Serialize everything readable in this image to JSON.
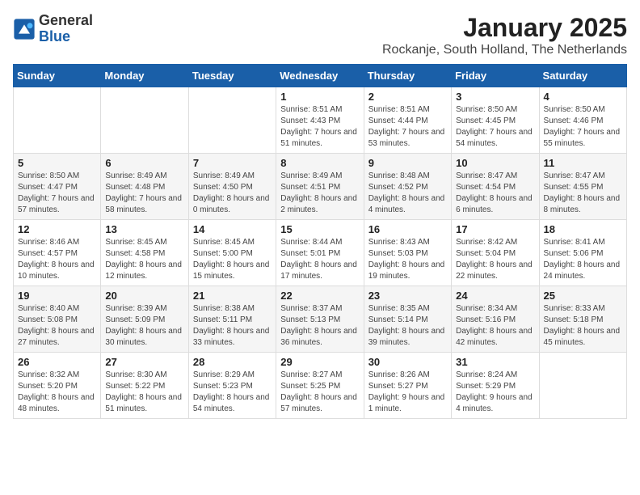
{
  "app": {
    "name_general": "General",
    "name_blue": "Blue"
  },
  "header": {
    "title": "January 2025",
    "subtitle": "Rockanje, South Holland, The Netherlands"
  },
  "calendar": {
    "days_of_week": [
      "Sunday",
      "Monday",
      "Tuesday",
      "Wednesday",
      "Thursday",
      "Friday",
      "Saturday"
    ],
    "weeks": [
      [
        {
          "day": "",
          "info": ""
        },
        {
          "day": "",
          "info": ""
        },
        {
          "day": "",
          "info": ""
        },
        {
          "day": "1",
          "info": "Sunrise: 8:51 AM\nSunset: 4:43 PM\nDaylight: 7 hours and 51 minutes."
        },
        {
          "day": "2",
          "info": "Sunrise: 8:51 AM\nSunset: 4:44 PM\nDaylight: 7 hours and 53 minutes."
        },
        {
          "day": "3",
          "info": "Sunrise: 8:50 AM\nSunset: 4:45 PM\nDaylight: 7 hours and 54 minutes."
        },
        {
          "day": "4",
          "info": "Sunrise: 8:50 AM\nSunset: 4:46 PM\nDaylight: 7 hours and 55 minutes."
        }
      ],
      [
        {
          "day": "5",
          "info": "Sunrise: 8:50 AM\nSunset: 4:47 PM\nDaylight: 7 hours and 57 minutes."
        },
        {
          "day": "6",
          "info": "Sunrise: 8:49 AM\nSunset: 4:48 PM\nDaylight: 7 hours and 58 minutes."
        },
        {
          "day": "7",
          "info": "Sunrise: 8:49 AM\nSunset: 4:50 PM\nDaylight: 8 hours and 0 minutes."
        },
        {
          "day": "8",
          "info": "Sunrise: 8:49 AM\nSunset: 4:51 PM\nDaylight: 8 hours and 2 minutes."
        },
        {
          "day": "9",
          "info": "Sunrise: 8:48 AM\nSunset: 4:52 PM\nDaylight: 8 hours and 4 minutes."
        },
        {
          "day": "10",
          "info": "Sunrise: 8:47 AM\nSunset: 4:54 PM\nDaylight: 8 hours and 6 minutes."
        },
        {
          "day": "11",
          "info": "Sunrise: 8:47 AM\nSunset: 4:55 PM\nDaylight: 8 hours and 8 minutes."
        }
      ],
      [
        {
          "day": "12",
          "info": "Sunrise: 8:46 AM\nSunset: 4:57 PM\nDaylight: 8 hours and 10 minutes."
        },
        {
          "day": "13",
          "info": "Sunrise: 8:45 AM\nSunset: 4:58 PM\nDaylight: 8 hours and 12 minutes."
        },
        {
          "day": "14",
          "info": "Sunrise: 8:45 AM\nSunset: 5:00 PM\nDaylight: 8 hours and 15 minutes."
        },
        {
          "day": "15",
          "info": "Sunrise: 8:44 AM\nSunset: 5:01 PM\nDaylight: 8 hours and 17 minutes."
        },
        {
          "day": "16",
          "info": "Sunrise: 8:43 AM\nSunset: 5:03 PM\nDaylight: 8 hours and 19 minutes."
        },
        {
          "day": "17",
          "info": "Sunrise: 8:42 AM\nSunset: 5:04 PM\nDaylight: 8 hours and 22 minutes."
        },
        {
          "day": "18",
          "info": "Sunrise: 8:41 AM\nSunset: 5:06 PM\nDaylight: 8 hours and 24 minutes."
        }
      ],
      [
        {
          "day": "19",
          "info": "Sunrise: 8:40 AM\nSunset: 5:08 PM\nDaylight: 8 hours and 27 minutes."
        },
        {
          "day": "20",
          "info": "Sunrise: 8:39 AM\nSunset: 5:09 PM\nDaylight: 8 hours and 30 minutes."
        },
        {
          "day": "21",
          "info": "Sunrise: 8:38 AM\nSunset: 5:11 PM\nDaylight: 8 hours and 33 minutes."
        },
        {
          "day": "22",
          "info": "Sunrise: 8:37 AM\nSunset: 5:13 PM\nDaylight: 8 hours and 36 minutes."
        },
        {
          "day": "23",
          "info": "Sunrise: 8:35 AM\nSunset: 5:14 PM\nDaylight: 8 hours and 39 minutes."
        },
        {
          "day": "24",
          "info": "Sunrise: 8:34 AM\nSunset: 5:16 PM\nDaylight: 8 hours and 42 minutes."
        },
        {
          "day": "25",
          "info": "Sunrise: 8:33 AM\nSunset: 5:18 PM\nDaylight: 8 hours and 45 minutes."
        }
      ],
      [
        {
          "day": "26",
          "info": "Sunrise: 8:32 AM\nSunset: 5:20 PM\nDaylight: 8 hours and 48 minutes."
        },
        {
          "day": "27",
          "info": "Sunrise: 8:30 AM\nSunset: 5:22 PM\nDaylight: 8 hours and 51 minutes."
        },
        {
          "day": "28",
          "info": "Sunrise: 8:29 AM\nSunset: 5:23 PM\nDaylight: 8 hours and 54 minutes."
        },
        {
          "day": "29",
          "info": "Sunrise: 8:27 AM\nSunset: 5:25 PM\nDaylight: 8 hours and 57 minutes."
        },
        {
          "day": "30",
          "info": "Sunrise: 8:26 AM\nSunset: 5:27 PM\nDaylight: 9 hours and 1 minute."
        },
        {
          "day": "31",
          "info": "Sunrise: 8:24 AM\nSunset: 5:29 PM\nDaylight: 9 hours and 4 minutes."
        },
        {
          "day": "",
          "info": ""
        }
      ]
    ]
  }
}
